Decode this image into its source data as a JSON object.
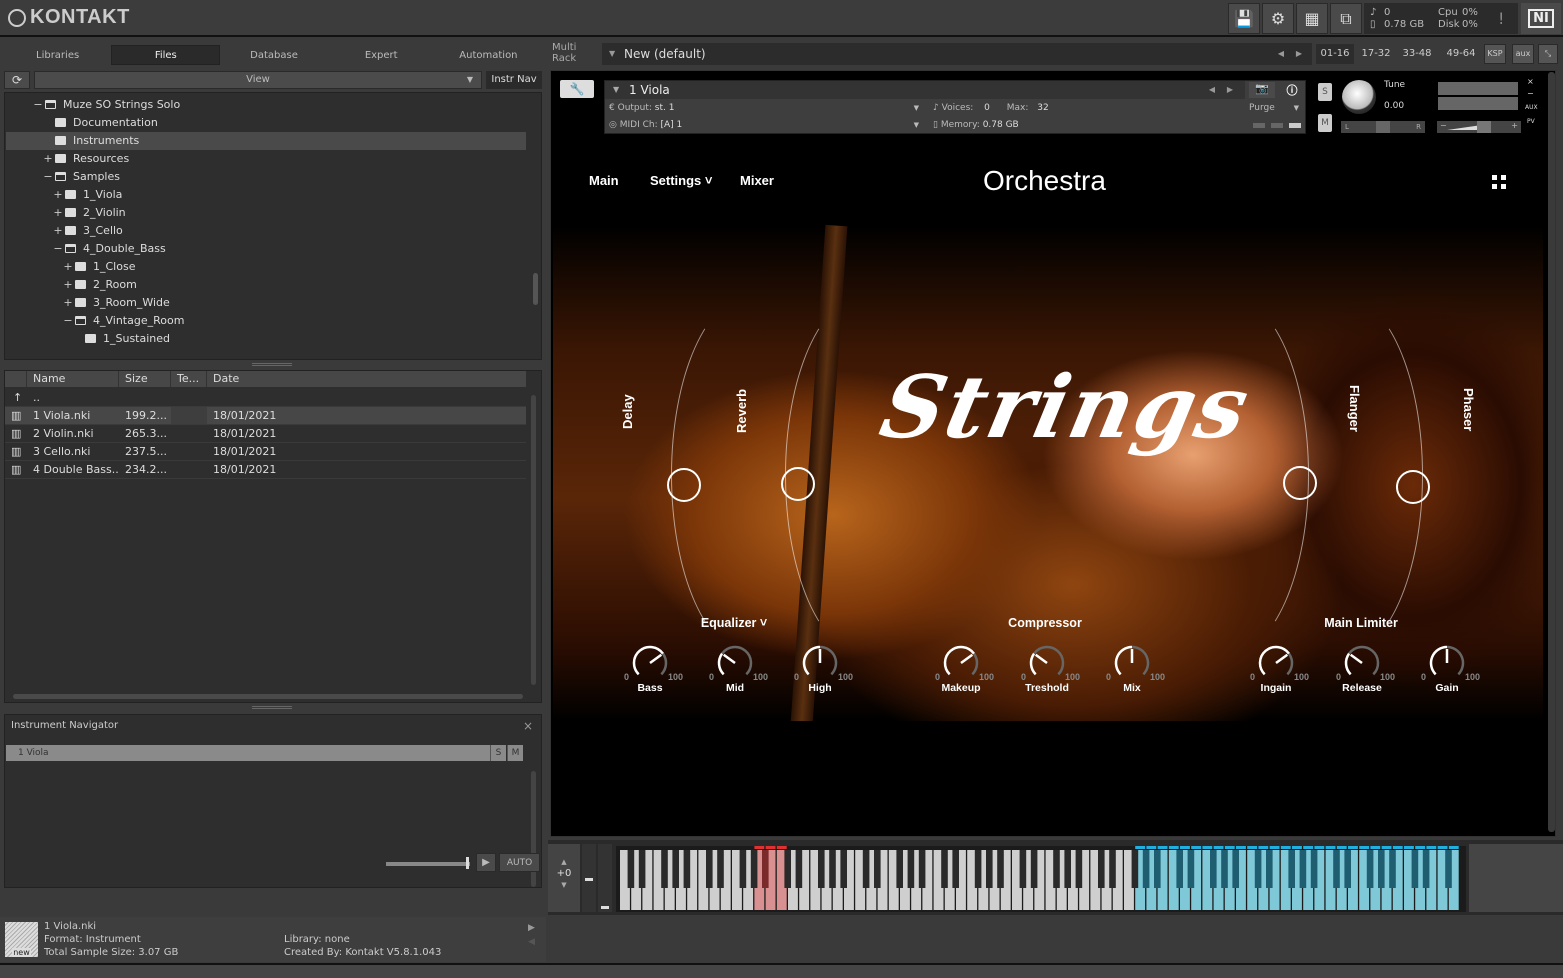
{
  "app": {
    "title": "KONTAKT"
  },
  "toolbar": {
    "icons": [
      "save-icon",
      "gear-icon",
      "layout-icon",
      "minimize-view-icon"
    ],
    "voices": "0",
    "memory": "0.78 GB",
    "cpu_label": "Cpu",
    "cpu": "0%",
    "disk_label": "Disk",
    "disk": "0%",
    "alert": "!",
    "ni_logo": "NI"
  },
  "browser": {
    "tabs": [
      "Libraries",
      "Files",
      "Database",
      "Expert",
      "Automation"
    ],
    "active_tab": "Files",
    "view_label": "View",
    "instr_nav_label": "Instr Nav",
    "tree": [
      {
        "label": "Muze SO Strings Solo",
        "toggle": "−",
        "open": true,
        "depth": 0
      },
      {
        "label": "Documentation",
        "toggle": "",
        "open": false,
        "depth": 1
      },
      {
        "label": "Instruments",
        "toggle": "",
        "open": false,
        "depth": 1,
        "selected": true
      },
      {
        "label": "Resources",
        "toggle": "+",
        "open": false,
        "depth": 1
      },
      {
        "label": "Samples",
        "toggle": "−",
        "open": true,
        "depth": 1
      },
      {
        "label": "1_Viola",
        "toggle": "+",
        "open": false,
        "depth": 2
      },
      {
        "label": "2_Violin",
        "toggle": "+",
        "open": false,
        "depth": 2
      },
      {
        "label": "3_Cello",
        "toggle": "+",
        "open": false,
        "depth": 2
      },
      {
        "label": "4_Double_Bass",
        "toggle": "−",
        "open": true,
        "depth": 2
      },
      {
        "label": "1_Close",
        "toggle": "+",
        "open": false,
        "depth": 3
      },
      {
        "label": "2_Room",
        "toggle": "+",
        "open": false,
        "depth": 3
      },
      {
        "label": "3_Room_Wide",
        "toggle": "+",
        "open": false,
        "depth": 3
      },
      {
        "label": "4_Vintage_Room",
        "toggle": "−",
        "open": true,
        "depth": 3
      },
      {
        "label": "1_Sustained",
        "toggle": "",
        "open": false,
        "depth": 4
      }
    ],
    "file_columns": [
      "Name",
      "Size",
      "Te...",
      "Date"
    ],
    "parent_row": "..",
    "files": [
      {
        "name": "1 Viola.nki",
        "size": "199.2...",
        "te": "",
        "date": "18/01/2021",
        "selected": true
      },
      {
        "name": "2 Violin.nki",
        "size": "265.3...",
        "te": "",
        "date": "18/01/2021"
      },
      {
        "name": "3 Cello.nki",
        "size": "237.5...",
        "te": "",
        "date": "18/01/2021"
      },
      {
        "name": "4 Double Bass....",
        "size": "234.2...",
        "te": "",
        "date": "18/01/2021"
      }
    ]
  },
  "navigator": {
    "title": "Instrument Navigator",
    "close": "×",
    "item": "1 Viola",
    "solo": "S",
    "mute": "M"
  },
  "preview": {
    "auto_label": "AUTO",
    "play": "▶"
  },
  "info": {
    "icon_label": "new",
    "file": "1 Viola.nki",
    "format": "Format: Instrument",
    "size": "Total Sample Size: 3.07 GB",
    "library": "Library: none",
    "created": "Created By: Kontakt V5.8.1.043"
  },
  "rack": {
    "label_line1": "Multi",
    "label_line2": "Rack",
    "preset": "New (default)",
    "pages": [
      "01-16",
      "17-32",
      "33-48",
      "49-64"
    ],
    "active_page": "01-16",
    "ksp": "KSP",
    "aux": "aux"
  },
  "instrument": {
    "name": "1 Viola",
    "output_label": "Output:",
    "output": "st. 1",
    "voices_label": "Voices:",
    "voices": "0",
    "max_label": "Max:",
    "max": "32",
    "purge": "Purge",
    "midi_label": "MIDI Ch:",
    "midi": "[A]  1",
    "memory_label": "Memory:",
    "memory": "0.78 GB",
    "solo": "S",
    "mute": "M",
    "tune_label": "Tune",
    "tune": "0.00",
    "pan_left": "L",
    "pan_right": "R",
    "vol_minus": "−",
    "vol_plus": "+",
    "side_labels": [
      "×",
      "−",
      "AUX",
      "PV"
    ]
  },
  "gui": {
    "nav": {
      "main": "Main",
      "settings": "Settings ˅",
      "mixer": "Mixer"
    },
    "title": "Orchestra",
    "logo": "Strings",
    "effects": [
      "Delay",
      "Reverb",
      "Flanger",
      "Phaser"
    ],
    "sections": [
      {
        "title": "Equalizer ˅",
        "knobs": [
          {
            "label": "Bass",
            "value": 70
          },
          {
            "label": "Mid",
            "value": 30
          },
          {
            "label": "High",
            "value": 50
          }
        ]
      },
      {
        "title": "Compressor",
        "knobs": [
          {
            "label": "Makeup",
            "value": 70
          },
          {
            "label": "Treshold",
            "value": 30
          },
          {
            "label": "Mix",
            "value": 50
          }
        ]
      },
      {
        "title": "Main Limiter",
        "knobs": [
          {
            "label": "Ingain",
            "value": 70
          },
          {
            "label": "Release",
            "value": 30
          },
          {
            "label": "Gain",
            "value": 50
          }
        ]
      }
    ],
    "knob_min": "0",
    "knob_max": "100"
  },
  "keyboard": {
    "octave": "+0",
    "red_range_white_keys": [
      12,
      14
    ],
    "blue_range_white_keys": [
      46,
      80
    ],
    "colors": {
      "red": "#d99090",
      "blue": "#7ec8d8",
      "red_dark": "#7a2a2a",
      "blue_dark": "#1e5e70"
    }
  }
}
